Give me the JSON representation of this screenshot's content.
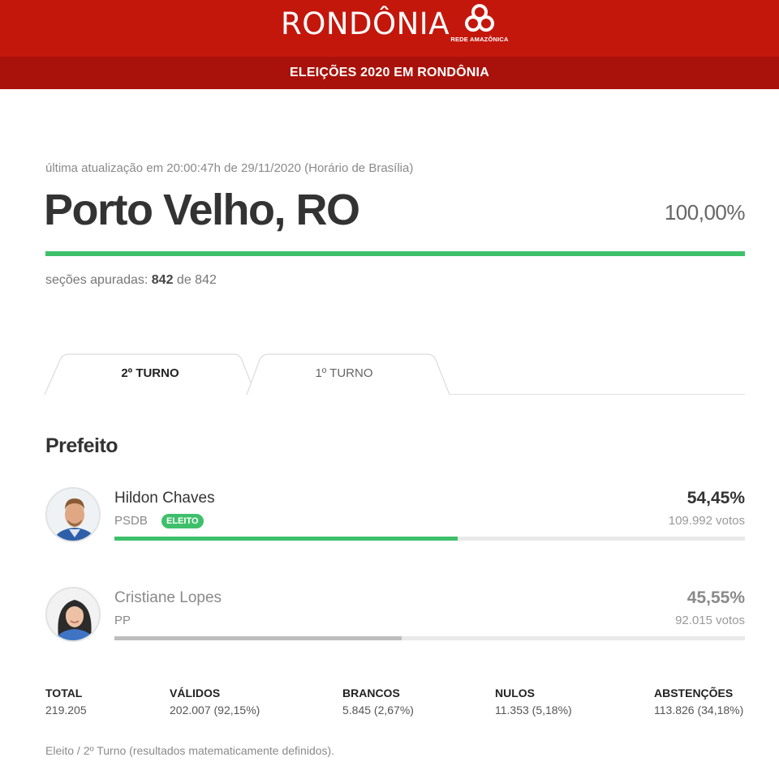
{
  "header": {
    "brand": "RONDÔNIA",
    "logo_text": "REDE AMAZÔNICA",
    "subtitle": "ELEIÇÕES 2020 EM RONDÔNIA",
    "color_primary": "#c4170c",
    "color_secondary": "#a9120a"
  },
  "summary": {
    "updated": "última atualização em 20:00:47h de 29/11/2020 (Horário de Brasília)",
    "city": "Porto Velho, RO",
    "percent_counted": "100,00%",
    "progress": 1.0,
    "sections_label": "seções apuradas:",
    "sections_counted": "842",
    "sections_of": "de",
    "sections_total": "842",
    "progress_color": "#3ec06a"
  },
  "tabs": [
    {
      "label": "2º TURNO",
      "active": true
    },
    {
      "label": "1º TURNO",
      "active": false
    }
  ],
  "race": {
    "title": "Prefeito",
    "candidates": [
      {
        "name": "Hildon Chaves",
        "party": "PSDB",
        "badge": "ELEITO",
        "percent": "54,45%",
        "votes": "109.992 votos",
        "share": 0.5445,
        "bar_color": "#3ec06a",
        "name_color": "#333333",
        "pct_color": "#333333",
        "avatar_icon": "male-candidate-photo"
      },
      {
        "name": "Cristiane Lopes",
        "party": "PP",
        "badge": "",
        "percent": "45,55%",
        "votes": "92.015 votos",
        "share": 0.4555,
        "bar_color": "#bdbdbd",
        "name_color": "#8a8a8a",
        "pct_color": "#8a8a8a",
        "avatar_icon": "female-candidate-photo"
      }
    ]
  },
  "stats": [
    {
      "label": "TOTAL",
      "value": "219.205"
    },
    {
      "label": "VÁLIDOS",
      "value": "202.007 (92,15%)"
    },
    {
      "label": "BRANCOS",
      "value": "5.845 (2,67%)"
    },
    {
      "label": "NULOS",
      "value": "11.353 (5,18%)"
    },
    {
      "label": "ABSTENÇÕES",
      "value": "113.826 (34,18%)"
    }
  ],
  "footnote": "Eleito / 2º Turno (resultados matematicamente definidos)."
}
